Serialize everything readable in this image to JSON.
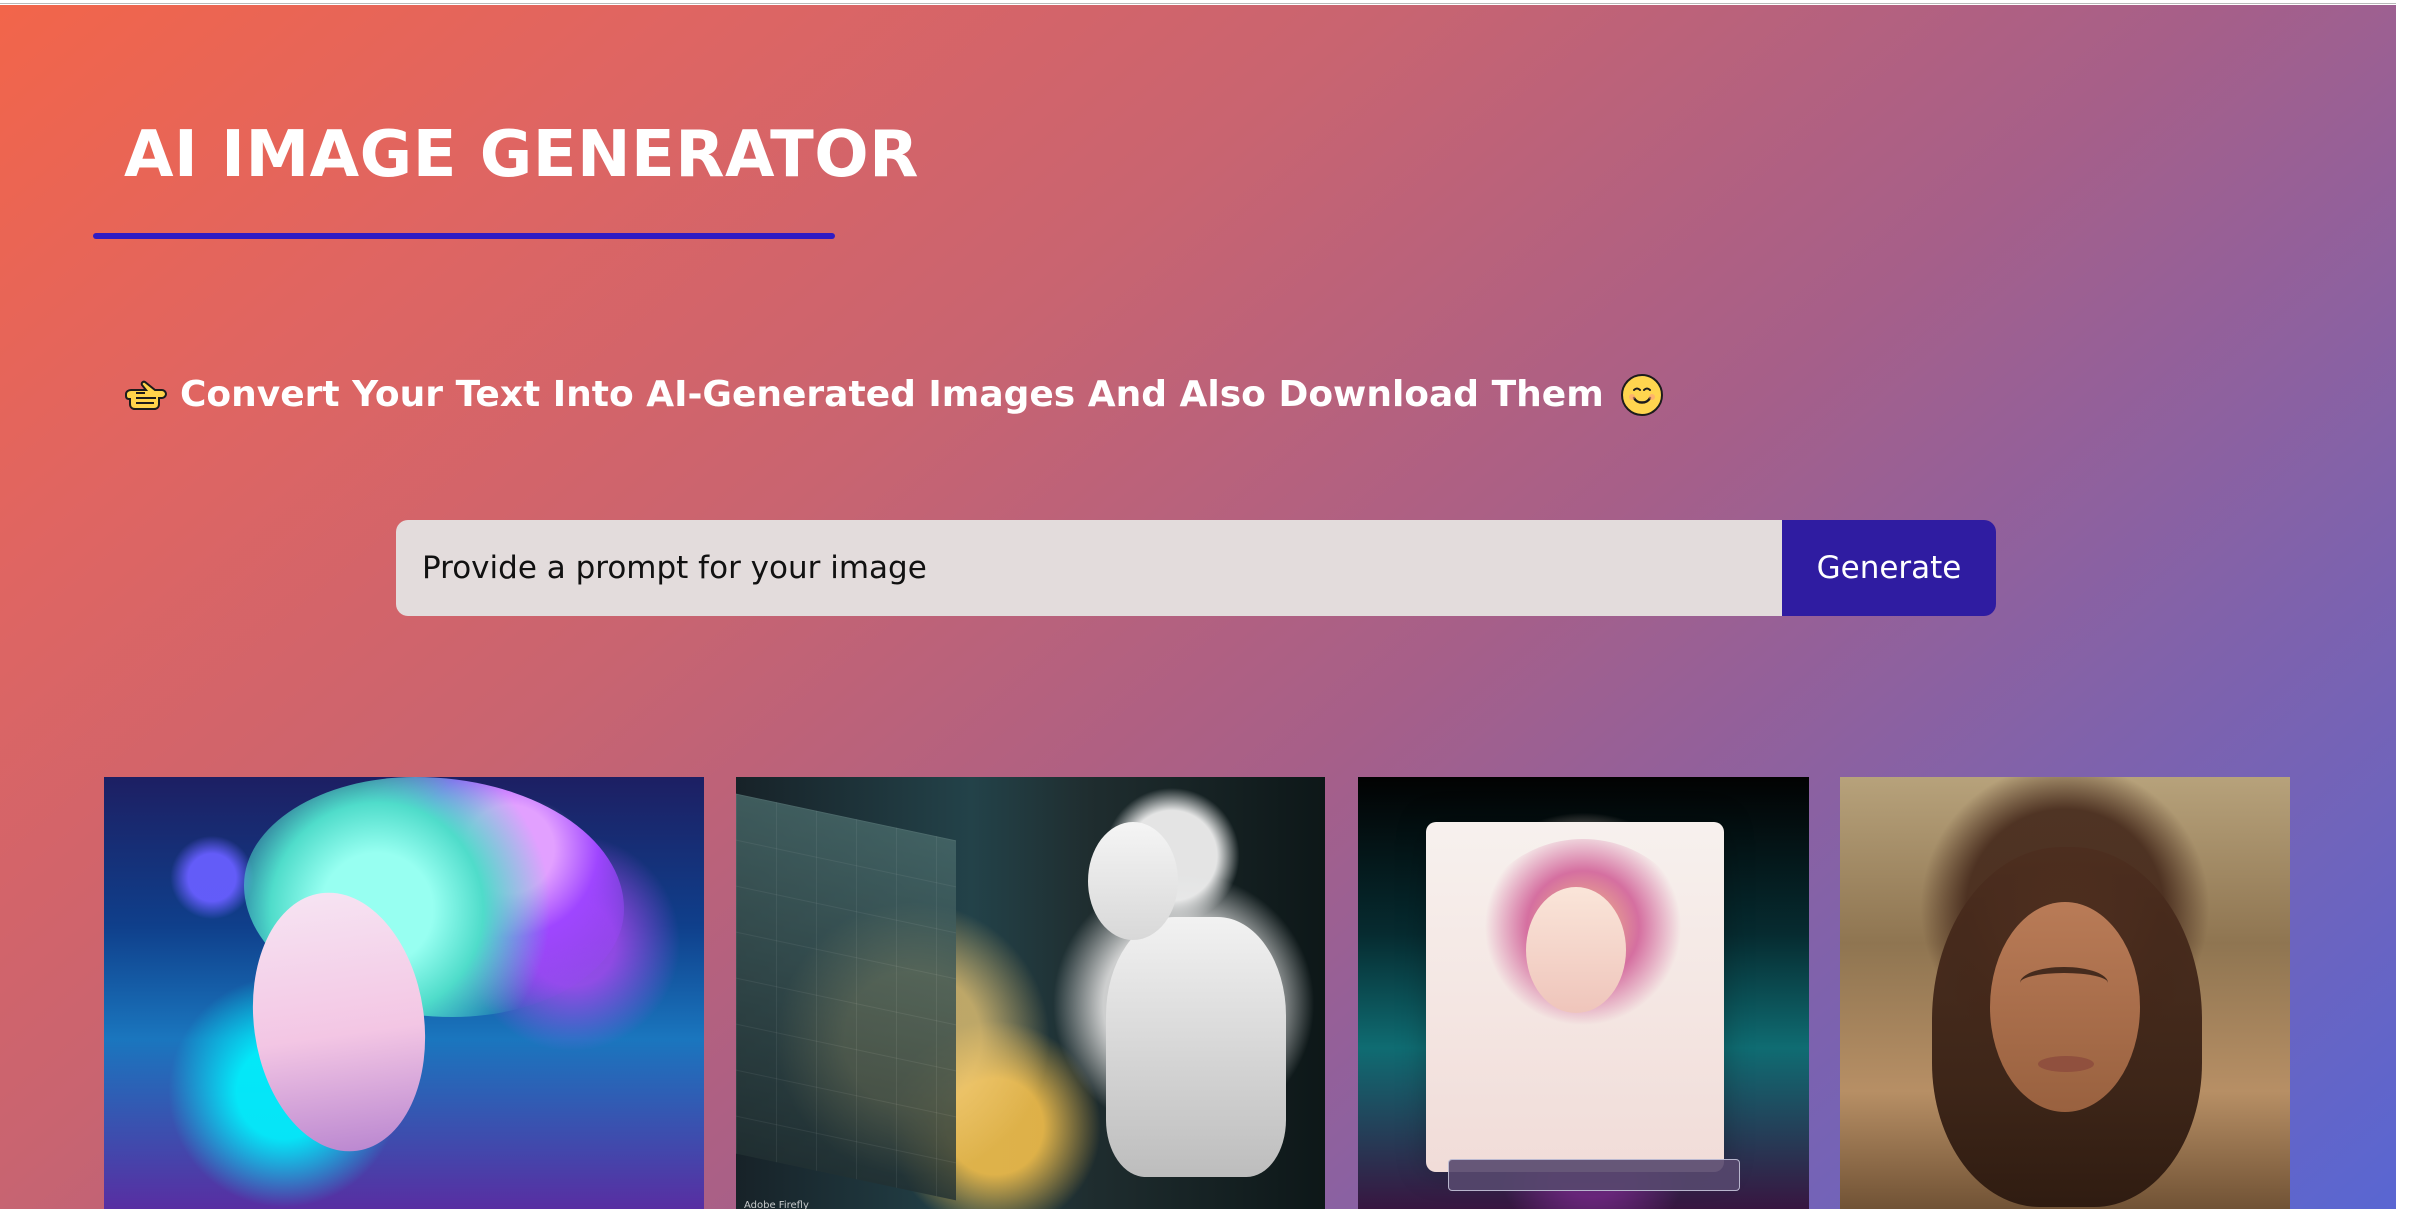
{
  "header": {
    "title": "AI IMAGE GENERATOR"
  },
  "intro": {
    "text": "Convert Your Text Into AI-Generated Images And Also Download Them",
    "leading_icon": "pointing-hand-icon",
    "trailing_icon": "smile-icon"
  },
  "prompt": {
    "placeholder": "Provide a prompt for your image",
    "button_label": "Generate"
  },
  "gallery": {
    "images": [
      {
        "label": "fantasy-woman-image"
      },
      {
        "label": "robot-image",
        "brand_text": "Adobe Firefly"
      },
      {
        "label": "flower-portrait-image"
      },
      {
        "label": "woman-portrait-image"
      }
    ]
  },
  "colors": {
    "accent": "#2f1bc4",
    "button": "#2f1ca1",
    "input_bg": "#e3dcdc",
    "text_light": "#ffffff"
  }
}
